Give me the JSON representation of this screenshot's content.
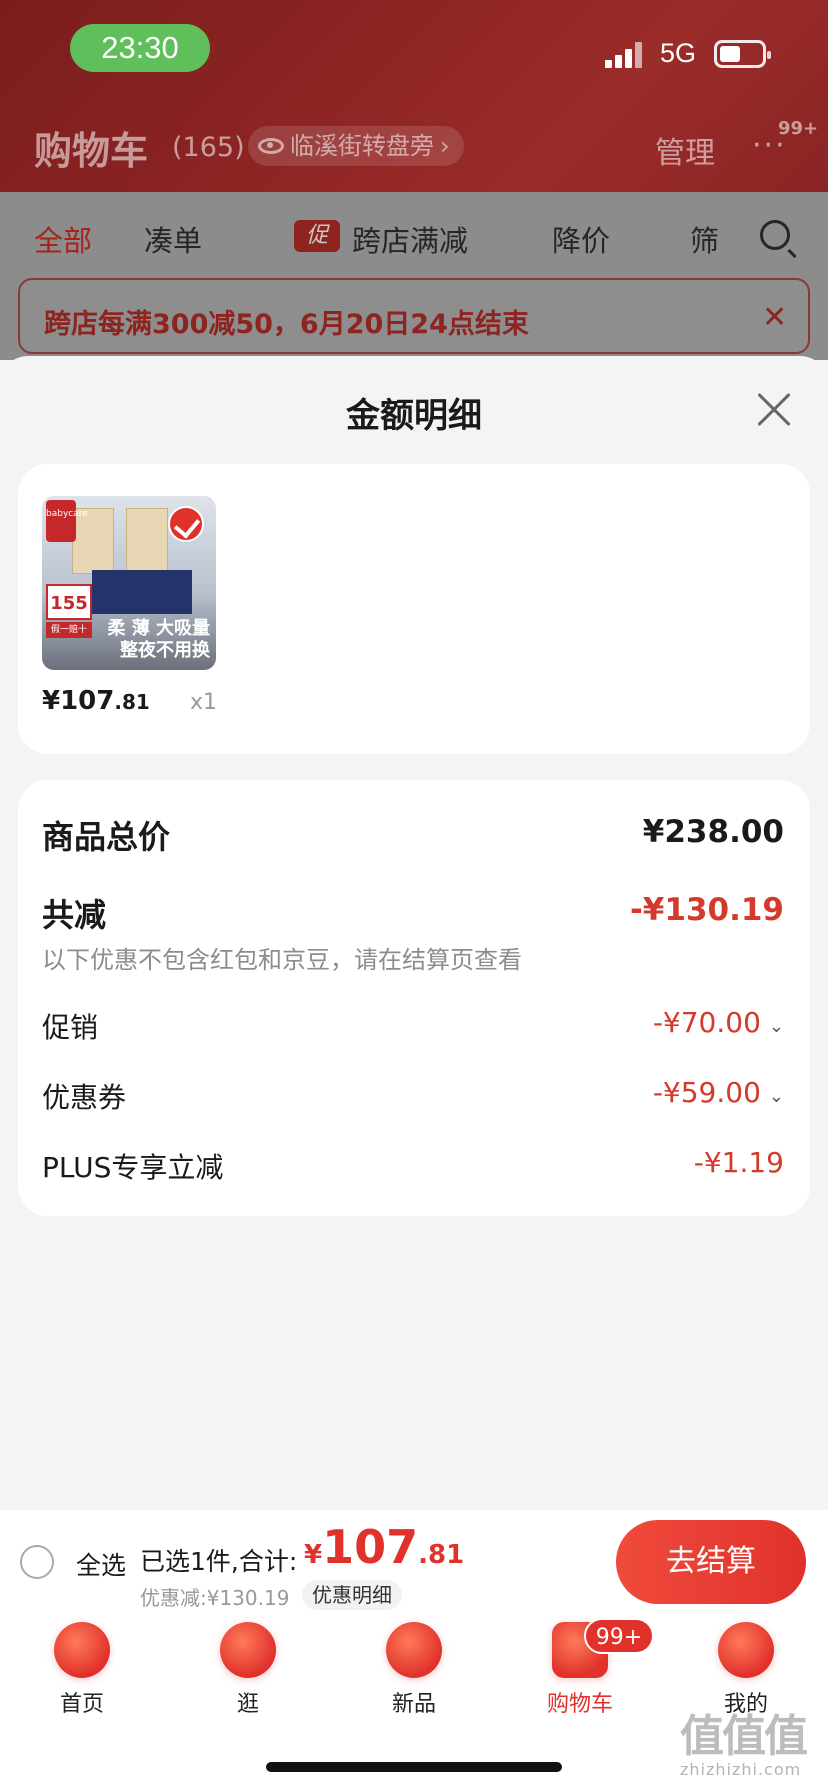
{
  "status_bar": {
    "time": "23:30",
    "network": "5G"
  },
  "header": {
    "title": "购物车",
    "count": "(165)",
    "address": "临溪街转盘旁",
    "manage": "管理",
    "more": "···",
    "badge": "99+"
  },
  "tabs": [
    "全部",
    "凑单",
    "跨店满减",
    "降价",
    "筛"
  ],
  "tab_promo_tag": "促",
  "banner": {
    "text": "跨店每满300减50，6月20日24点结束"
  },
  "sheet": {
    "title": "金额明细"
  },
  "product": {
    "image_brand": "babycare",
    "image_price": "155",
    "image_price_sub": "假一赔十",
    "image_slogan_1": "柔 薄 大吸量",
    "image_slogan_2": "整夜不用换",
    "price_int": "¥107",
    "price_dec": ".81",
    "qty": "x1"
  },
  "summary": {
    "total_label": "商品总价",
    "total_value": "¥238.00",
    "reduce_label": "共减",
    "reduce_value": "-¥130.19",
    "note": "以下优惠不包含红包和京豆，请在结算页查看",
    "promo_label": "促销",
    "promo_value": "-¥70.00",
    "coupon_label": "优惠券",
    "coupon_value": "-¥59.00",
    "plus_label": "PLUS专享立减",
    "plus_value": "-¥1.19"
  },
  "checkout_bar": {
    "select_all": "全选",
    "selected_text": "已选1件,合计:",
    "currency": "¥",
    "total_int": "107",
    "total_dec": ".81",
    "discount_text": "优惠减:¥130.19",
    "detail_button": "优惠明细",
    "checkout_button": "去结算"
  },
  "nav": [
    {
      "label": "首页"
    },
    {
      "label": "逛"
    },
    {
      "label": "新品"
    },
    {
      "label": "购物车",
      "badge": "99+"
    },
    {
      "label": "我的"
    }
  ],
  "watermark": {
    "main": "值值值",
    "sub": "zhizhizhi.com"
  },
  "colors": {
    "accent": "#e0312b",
    "discount_text": "#d33a2c",
    "header_bg": "#8f2525"
  }
}
